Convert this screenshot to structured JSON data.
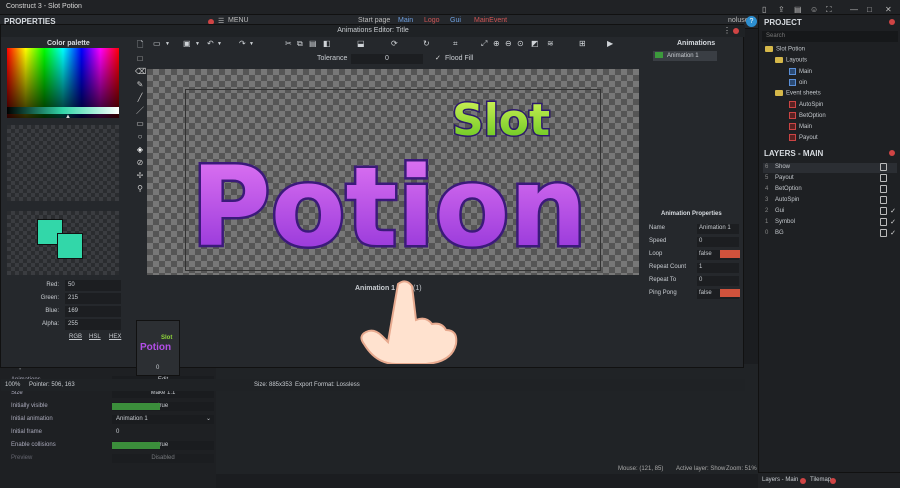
{
  "window": {
    "title": "Construct 3 - Slot Potion"
  },
  "ribbon": {
    "properties_title": "PROPERTIES",
    "menu": "MENU",
    "tabs": [
      "Start page",
      "Main",
      "Logo",
      "Gui",
      "MainEvent"
    ],
    "user": "noluser"
  },
  "editor": {
    "title": "Animations Editor: Title",
    "color_palette_title": "Color palette",
    "tolerance_label": "Tolerance",
    "tolerance_value": "0",
    "flood_fill_label": "Flood Fill",
    "color": {
      "red_label": "Red:",
      "red": "50",
      "green_label": "Green:",
      "green": "215",
      "blue_label": "Blue:",
      "blue": "169",
      "alpha_label": "Alpha:",
      "alpha": "255",
      "modes": [
        "RGB",
        "HSL",
        "HEX"
      ]
    },
    "primary_color": "#32d7a9",
    "image_text_top": "Slot",
    "image_text_main": "Potion",
    "frames_label": "Animation 1",
    "frames_suffix": "(1)",
    "frame_index": "0",
    "thumb_top": "Slot",
    "thumb_main": "Potion",
    "status": {
      "zoom": "100%",
      "pointer": "Pointer: 506, 163",
      "size": "Size: 885x353",
      "export": "Export Format: Lossless"
    }
  },
  "animations_panel": {
    "title": "Animations",
    "items": [
      "Animation 1"
    ],
    "properties_title": "Animation Properties",
    "props": [
      {
        "key": "Name",
        "value": "Animation 1"
      },
      {
        "key": "Speed",
        "value": "0"
      },
      {
        "key": "Loop",
        "value": "false"
      },
      {
        "key": "Repeat Count",
        "value": "1"
      },
      {
        "key": "Repeat To",
        "value": "0"
      },
      {
        "key": "Ping Pong",
        "value": "false"
      }
    ]
  },
  "properties": {
    "section": "Properties",
    "rows": [
      {
        "key": "Animations",
        "value": "Edit"
      },
      {
        "key": "Size",
        "value": "Make 1:1"
      },
      {
        "key": "Initially visible",
        "value": "true"
      },
      {
        "key": "Initial animation",
        "value": "Animation 1"
      },
      {
        "key": "Initial frame",
        "value": "0"
      },
      {
        "key": "Enable collisions",
        "value": "true"
      },
      {
        "key": "Preview",
        "value": "Disabled"
      }
    ]
  },
  "project": {
    "title": "PROJECT",
    "search_placeholder": "Search",
    "root": "Slot Potion",
    "layouts_folder": "Layouts",
    "layouts": [
      "Main",
      "oin"
    ],
    "events_folder": "Event sheets",
    "event_sheets": [
      "AutoSpin",
      "BetOption",
      "Main",
      "Payout",
      "WinEffect"
    ]
  },
  "layers": {
    "title": "LAYERS - MAIN",
    "items": [
      {
        "num": "6",
        "name": "Show"
      },
      {
        "num": "5",
        "name": "Payout"
      },
      {
        "num": "4",
        "name": "BetOption"
      },
      {
        "num": "3",
        "name": "AutoSpin"
      },
      {
        "num": "2",
        "name": "Gui"
      },
      {
        "num": "1",
        "name": "Symbol"
      },
      {
        "num": "0",
        "name": "BG"
      }
    ]
  },
  "bottom_tabs": [
    "Layers - Main",
    "Tilemap"
  ],
  "layout_status": {
    "mouse": "Mouse: (121, 85)",
    "active_layer": "Active layer: Show",
    "zoom": "Zoom: 51%"
  }
}
